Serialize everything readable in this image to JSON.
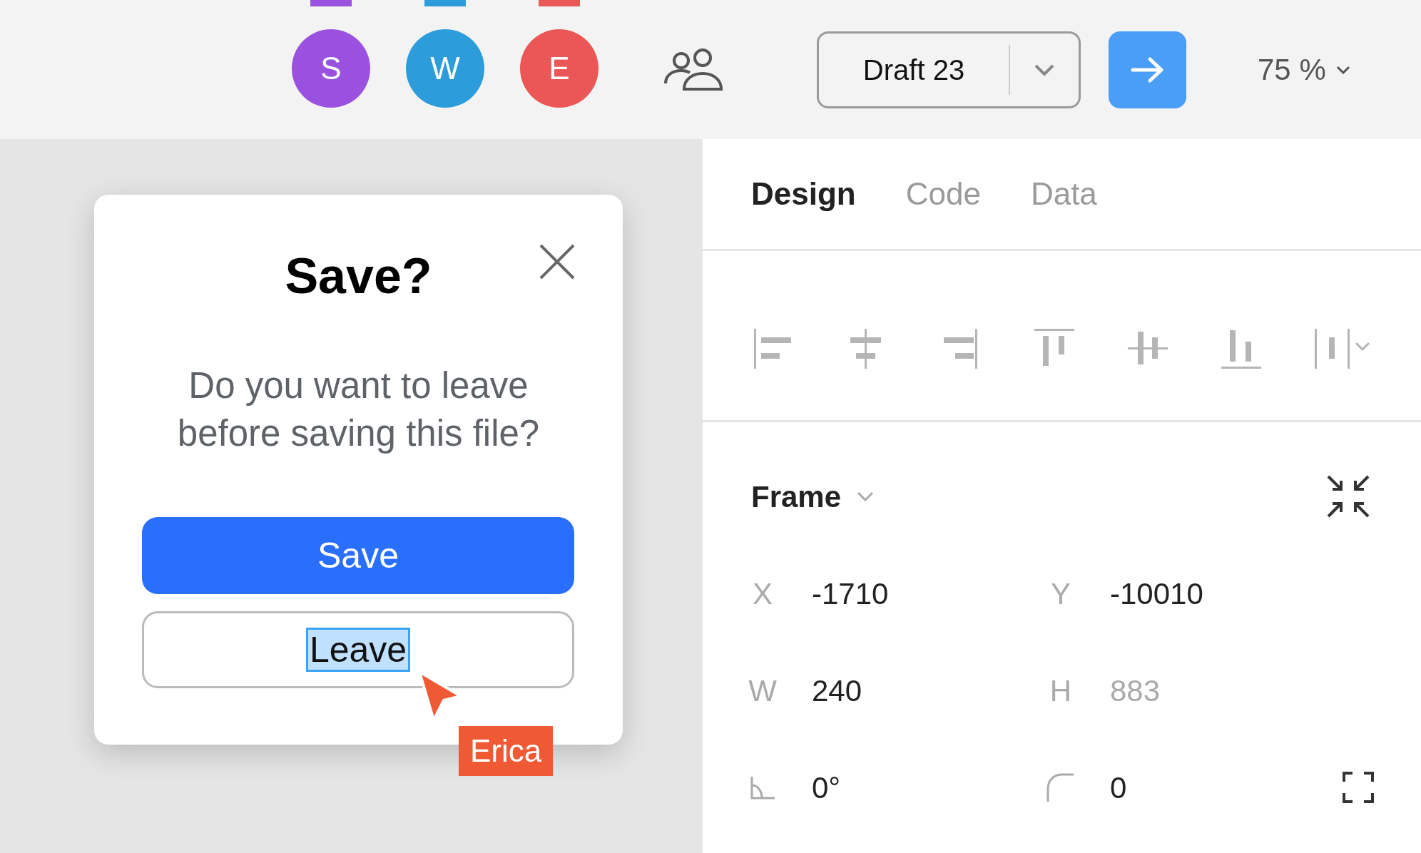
{
  "collaborators": [
    {
      "initial": "S",
      "color": "#9b51e0"
    },
    {
      "initial": "W",
      "color": "#2d9cdb"
    },
    {
      "initial": "E",
      "color": "#eb5757"
    }
  ],
  "version": {
    "label": "Draft 23"
  },
  "zoom": "75 %",
  "dialog": {
    "title": "Save?",
    "message": "Do you want to leave before saving this file?",
    "buttons": [
      {
        "label": "Save",
        "kind": "primary",
        "highlighted": false
      },
      {
        "label": "Leave",
        "kind": "secondary",
        "highlighted": true
      }
    ]
  },
  "cursor": {
    "name": "Erica",
    "color": "#ef5a35"
  },
  "tabs": [
    {
      "label": "Design",
      "selected": true
    },
    {
      "label": "Code",
      "selected": false
    },
    {
      "label": "Data",
      "selected": false
    }
  ],
  "frame": {
    "title": "Frame",
    "fields": [
      {
        "kind": "text",
        "label": "X",
        "value": "-1710",
        "disabled": false
      },
      {
        "kind": "text",
        "label": "Y",
        "value": "-10010",
        "disabled": false
      },
      {
        "kind": "text",
        "label": "W",
        "value": "240",
        "disabled": false
      },
      {
        "kind": "text",
        "label": "H",
        "value": "883",
        "disabled": true
      },
      {
        "kind": "rotation",
        "value": "0°",
        "disabled": false
      },
      {
        "kind": "radius",
        "value": "0",
        "disabled": false
      }
    ]
  }
}
